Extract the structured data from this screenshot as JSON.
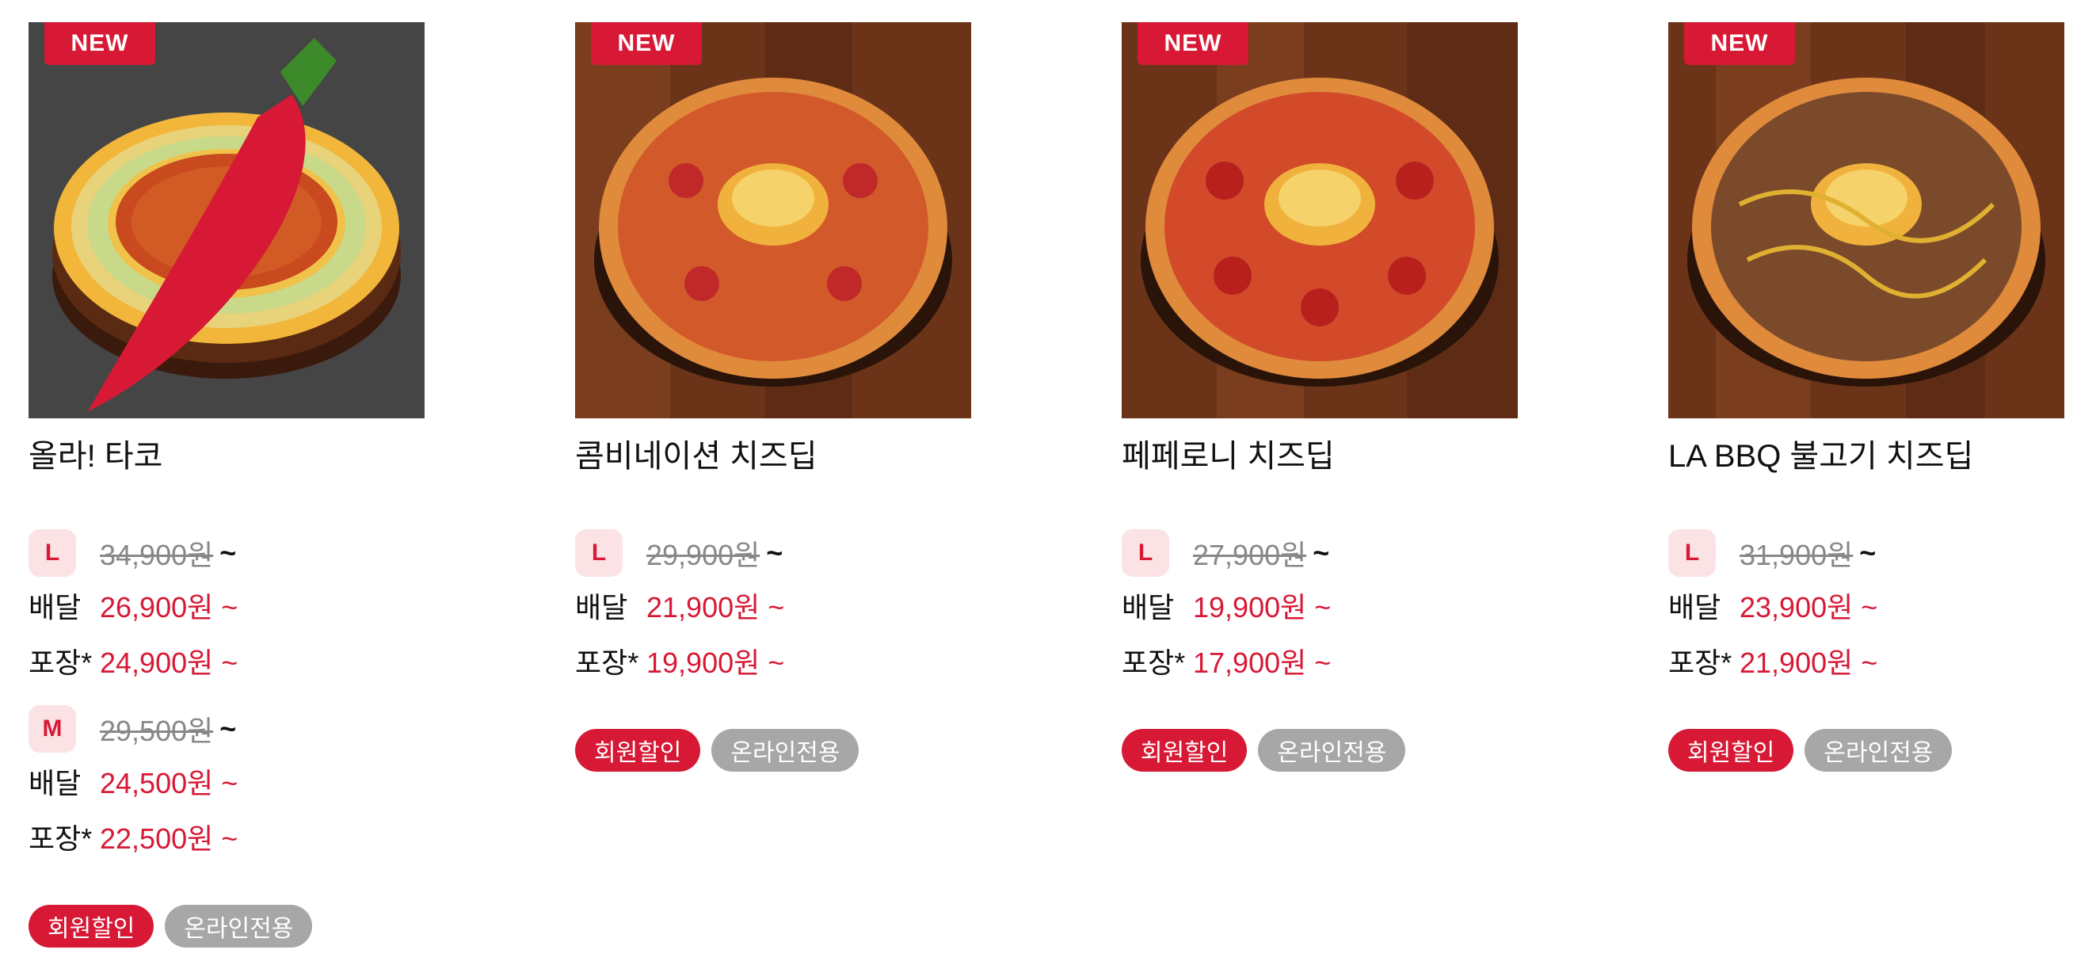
{
  "colors": {
    "accent": "#d71935",
    "muted_tag": "#a7a7a7",
    "size_badge_bg": "#fbe3e5"
  },
  "products": [
    {
      "badge": "NEW",
      "spicy_icon": "chili-pepper-icon",
      "name": "올라! 타코",
      "sizes": [
        {
          "size": "L",
          "original_price": "34,900원",
          "delivery_label": "배달",
          "delivery_price": "26,900원 ~",
          "pickup_label": "포장*",
          "pickup_price": "24,900원 ~"
        },
        {
          "size": "M",
          "original_price": "29,500원",
          "delivery_label": "배달",
          "delivery_price": "24,500원 ~",
          "pickup_label": "포장*",
          "pickup_price": "22,500원 ~"
        }
      ],
      "tags": [
        "회원할인",
        "온라인전용"
      ]
    },
    {
      "badge": "NEW",
      "name": "콤비네이션 치즈딥",
      "sizes": [
        {
          "size": "L",
          "original_price": "29,900원",
          "delivery_label": "배달",
          "delivery_price": "21,900원 ~",
          "pickup_label": "포장*",
          "pickup_price": "19,900원 ~"
        }
      ],
      "tags": [
        "회원할인",
        "온라인전용"
      ]
    },
    {
      "badge": "NEW",
      "name": "페페로니 치즈딥",
      "sizes": [
        {
          "size": "L",
          "original_price": "27,900원",
          "delivery_label": "배달",
          "delivery_price": "19,900원 ~",
          "pickup_label": "포장*",
          "pickup_price": "17,900원 ~"
        }
      ],
      "tags": [
        "회원할인",
        "온라인전용"
      ]
    },
    {
      "badge": "NEW",
      "name": "LA BBQ 불고기 치즈딥",
      "sizes": [
        {
          "size": "L",
          "original_price": "31,900원",
          "delivery_label": "배달",
          "delivery_price": "23,900원 ~",
          "pickup_label": "포장*",
          "pickup_price": "21,900원 ~"
        }
      ],
      "tags": [
        "회원할인",
        "온라인전용"
      ]
    }
  ]
}
